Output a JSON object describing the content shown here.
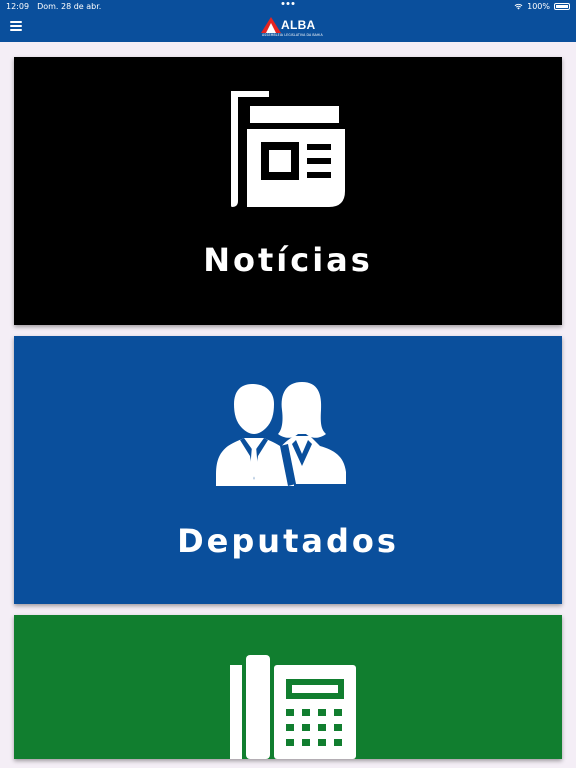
{
  "status": {
    "time": "12:09",
    "date": "Dom. 28 de abr.",
    "battery": "100%",
    "wifi_icon": "wifi-icon",
    "battery_icon": "battery-icon"
  },
  "header": {
    "menu_icon": "hamburger-menu-icon",
    "logo_text": "ALBA",
    "logo_subtitle": "ASSEMBLEIA LEGISLATIVA DA BAHIA"
  },
  "cards": [
    {
      "label": "Notícias",
      "icon": "newspaper-icon",
      "color": "#000000"
    },
    {
      "label": "Deputados",
      "icon": "people-icon",
      "color": "#0a4f9c"
    },
    {
      "label": "",
      "icon": "telephone-icon",
      "color": "#117e2f"
    }
  ],
  "colors": {
    "navbar": "#0a4f9c",
    "logo_red": "#e52421",
    "background": "#f4eef6"
  }
}
